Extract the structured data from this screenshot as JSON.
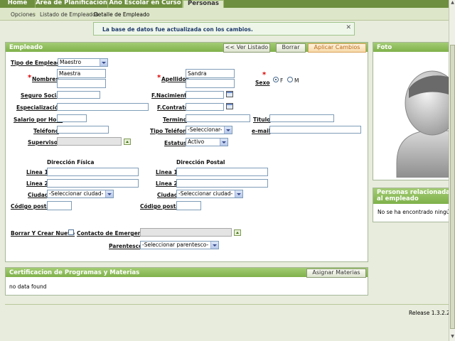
{
  "nav": {
    "tabs": [
      "Home",
      "Area de Planificacion",
      "Año Escolar en Curso",
      "Personas"
    ],
    "active_tab": "Personas"
  },
  "breadcrumb": [
    "Opciones",
    "Listado de Empleados",
    "Detalle de Empleado"
  ],
  "message": "La base de datos fue actualizada con los cambios.",
  "empleado_panel": {
    "title": "Empleado",
    "buttons": {
      "ver_listado": "<< Ver Listado",
      "borrar": "Borrar",
      "aplicar": "Aplicar Cambios"
    },
    "fields": {
      "tipo_empleado_label": "Tipo de Empleado",
      "tipo_empleado_value": "Maestro",
      "nombres_label": "Nombres",
      "nombres_value": "Maestra",
      "apellidos_label": "Apellidos",
      "apellidos_value": "Sandra",
      "sexo_label": "Sexo",
      "sexo_f": "F",
      "sexo_m": "M",
      "seguro_social_label": "Seguro Social",
      "f_nacimiento_label": "F.Nacimiento",
      "especializacion_label": "Especialización",
      "f_contrato_label": "F.Contrato",
      "salario_label": "Salario por Hora",
      "termino_label": "Termino",
      "titulo_label": "Titulo",
      "telefono_label": "Teléfono",
      "tipo_telefono_label": "Tipo Teléfono",
      "tipo_telefono_value": "-Seleccionar-",
      "email_label": "e-mail",
      "supervisor_label": "Supervisor",
      "estatus_label": "Estatus",
      "estatus_value": "Activo"
    },
    "direccion_fisica": "Dirección Física",
    "direccion_postal": "Dirección Postal",
    "linea1": "Linea 1",
    "linea2": "Linea 2",
    "ciudad": "Ciudad",
    "ciudad_value": "-Seleccionar ciudad-",
    "codigo_postal": "Código postal",
    "borrar_crear_nuevo": "Borrar Y Crear Nuevo",
    "contacto_emergencia": "Contacto de Emergencia",
    "parentesco_label": "Parentesco",
    "parentesco_value": "-Seleccionar parentesco-"
  },
  "foto_panel": {
    "title": "Foto"
  },
  "relacionadas_panel": {
    "title": "Personas relacionadas al empleado",
    "empty_text": "No se ha encontrado ningún"
  },
  "certificacion_panel": {
    "title": "Certificacion de Programas y Materias",
    "button": "Asignar Materias",
    "empty_text": "no data found"
  },
  "footer": {
    "release": "Release 1.3.2.2"
  }
}
